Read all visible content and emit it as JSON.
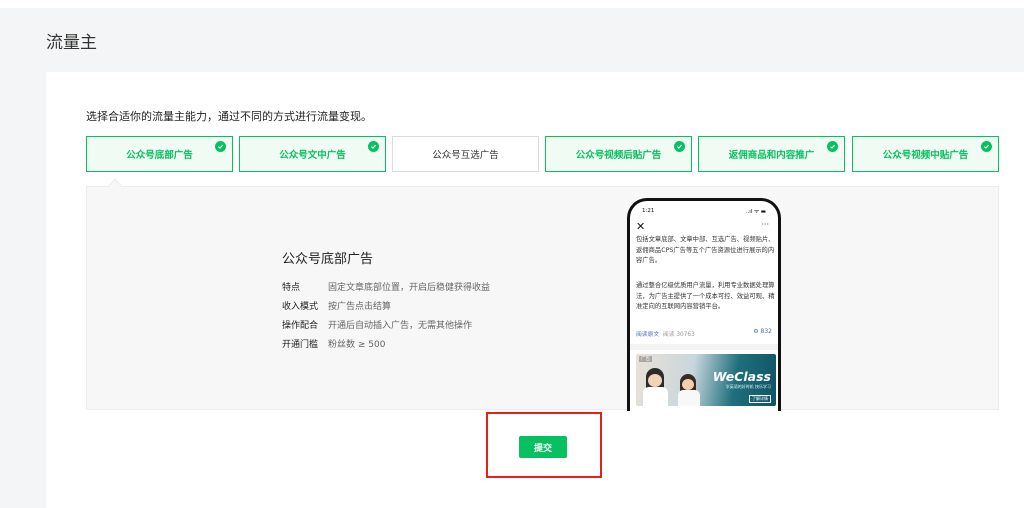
{
  "page_title": "流量主",
  "intro": "选择合适你的流量主能力，通过不同的方式进行流量变现。",
  "tabs": [
    {
      "label": "公众号底部广告",
      "checked": true
    },
    {
      "label": "公众号文中广告",
      "checked": true
    },
    {
      "label": "公众号互选广告",
      "checked": false
    },
    {
      "label": "公众号视频后贴广告",
      "checked": true
    },
    {
      "label": "返佣商品和内容推广",
      "checked": true
    },
    {
      "label": "公众号视频中贴广告",
      "checked": true
    }
  ],
  "detail": {
    "title": "公众号底部广告",
    "rows": [
      {
        "key": "特点",
        "value": "固定文章底部位置，开启后稳健获得收益"
      },
      {
        "key": "收入模式",
        "value": "按广告点击结算"
      },
      {
        "key": "操作配合",
        "value": "开通后自动插入广告，无需其他操作"
      },
      {
        "key": "开通门槛",
        "value": "粉丝数 ≥ 500"
      }
    ]
  },
  "phone": {
    "time": "1:21",
    "status_icons": "..ıl ᯤ ▬",
    "close": "✕",
    "more": "···",
    "para1": "包括文章底部、文章中部、互选广告、视频贴片、返佣商品CPS广告等五个广告资源位进行展示的内容广告。",
    "para2": "通过整合亿级优质用户流量，利用专业数据处理算法，为广告主提供了一个成本可控、效益可观、精准定向的互联网内容营销平台。",
    "read_more": "阅读原文",
    "reads": "阅读 30763",
    "likes": "832",
    "ad_label": "广告",
    "ad_brand": "WeClass",
    "ad_slogan": "学英语的好时机 快乐学习",
    "ad_cta": "了解详情"
  },
  "submit_label": "提交",
  "colors": {
    "accent": "#07c160",
    "highlight": "#e4211b"
  }
}
